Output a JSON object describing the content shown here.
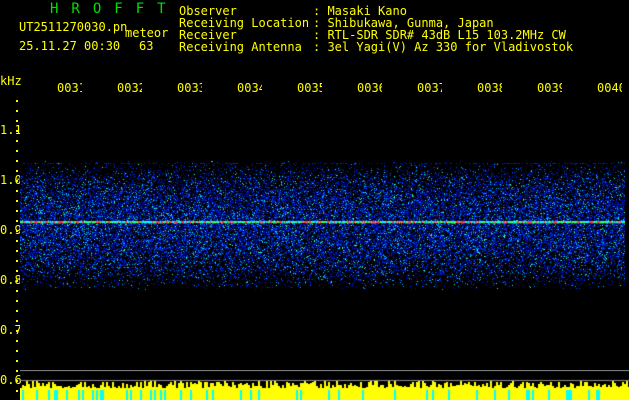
{
  "header": {
    "title": "HROFFT",
    "filename": "UT2511270030.pn",
    "mode": "meteor",
    "datetime": "25.11.27 00:30",
    "count": "63"
  },
  "info": [
    {
      "label": "Observer",
      "value": ": Masaki Kano"
    },
    {
      "label": "Receiving Location",
      "value": ": Shibukawa, Gunma, Japan"
    },
    {
      "label": "Receiver",
      "value": ": RTL-SDR SDR# 43dB L15 103.2MHz CW"
    },
    {
      "label": "Receiving Antenna",
      "value": ": 3el Yagi(V) Az 330 for Vladivostok"
    }
  ],
  "axis": {
    "unit": "kHz",
    "x_labels": [
      "0031",
      "0032",
      "0033",
      "0034",
      "0035",
      "0036",
      "0037",
      "0038",
      "0039",
      "0040"
    ],
    "y_labels": [
      "1.1",
      "1.0",
      "0.9",
      "0.8",
      "0.7",
      "0.6"
    ]
  },
  "colors": {
    "text": "#ffff00",
    "title": "#00e000",
    "bars": "#ffff00",
    "bars_low": "#00ffff"
  }
}
